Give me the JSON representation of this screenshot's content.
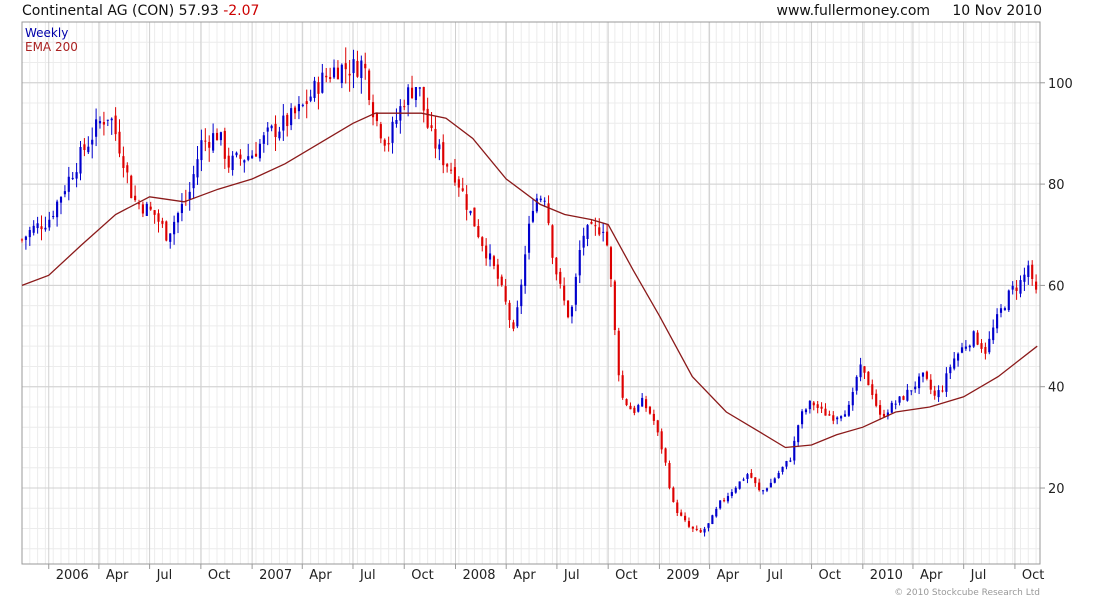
{
  "header": {
    "instrument": "Continental AG (CON)",
    "price": "57.93",
    "change": "-2.07",
    "website": "www.fullermoney.com",
    "date": "10 Nov 2010"
  },
  "footer": {
    "copyright": "© 2010 Stockcube Research Ltd"
  },
  "colors": {
    "up": "#0000cc",
    "down": "#dd0000",
    "ema": "#8b1a1a",
    "grid": "#d0d0d0",
    "frame": "#999999"
  },
  "chart_data": {
    "type": "candlestick",
    "frequency": "Weekly",
    "legend": [
      "Weekly",
      "EMA 200"
    ],
    "legend_position": "top-left",
    "ylim": [
      5,
      112
    ],
    "y_ticks": [
      20,
      40,
      60,
      80,
      100
    ],
    "y_axis_side": "right",
    "grid": true,
    "xlim": [
      "2005-11-14",
      "2010-11-15"
    ],
    "x_ticks": [
      {
        "label": "2006",
        "date": "2006-01-01"
      },
      {
        "label": "Apr",
        "date": "2006-04-01"
      },
      {
        "label": "Jul",
        "date": "2006-07-01"
      },
      {
        "label": "Oct",
        "date": "2006-10-01"
      },
      {
        "label": "2007",
        "date": "2007-01-01"
      },
      {
        "label": "Apr",
        "date": "2007-04-01"
      },
      {
        "label": "Jul",
        "date": "2007-07-01"
      },
      {
        "label": "Oct",
        "date": "2007-10-01"
      },
      {
        "label": "2008",
        "date": "2008-01-01"
      },
      {
        "label": "Apr",
        "date": "2008-04-01"
      },
      {
        "label": "Jul",
        "date": "2008-07-01"
      },
      {
        "label": "Oct",
        "date": "2008-10-01"
      },
      {
        "label": "2009",
        "date": "2009-01-01"
      },
      {
        "label": "Apr",
        "date": "2009-04-01"
      },
      {
        "label": "Jul",
        "date": "2009-07-01"
      },
      {
        "label": "Oct",
        "date": "2009-10-01"
      },
      {
        "label": "2010",
        "date": "2010-01-01"
      },
      {
        "label": "Apr",
        "date": "2010-04-01"
      },
      {
        "label": "Jul",
        "date": "2010-07-01"
      },
      {
        "label": "Oct",
        "date": "2010-10-01"
      }
    ],
    "price_path": [
      [
        "2005-11-14",
        69
      ],
      [
        "2005-12-01",
        71
      ],
      [
        "2006-01-01",
        73
      ],
      [
        "2006-02-01",
        80
      ],
      [
        "2006-03-01",
        86
      ],
      [
        "2006-04-01",
        92
      ],
      [
        "2006-04-20",
        94
      ],
      [
        "2006-05-15",
        85
      ],
      [
        "2006-06-01",
        77
      ],
      [
        "2006-06-15",
        76
      ],
      [
        "2006-07-10",
        74
      ],
      [
        "2006-08-01",
        70
      ],
      [
        "2006-08-20",
        74
      ],
      [
        "2006-09-10",
        78
      ],
      [
        "2006-10-01",
        88
      ],
      [
        "2006-11-01",
        90
      ],
      [
        "2006-11-20",
        84
      ],
      [
        "2006-12-10",
        85
      ],
      [
        "2007-01-01",
        86
      ],
      [
        "2007-02-01",
        90
      ],
      [
        "2007-03-01",
        92
      ],
      [
        "2007-04-01",
        95
      ],
      [
        "2007-05-01",
        100
      ],
      [
        "2007-06-01",
        103
      ],
      [
        "2007-07-01",
        103
      ],
      [
        "2007-07-20",
        104
      ],
      [
        "2007-08-10",
        93
      ],
      [
        "2007-09-01",
        88
      ],
      [
        "2007-10-01",
        97
      ],
      [
        "2007-10-25",
        100
      ],
      [
        "2007-11-15",
        90
      ],
      [
        "2007-12-10",
        85
      ],
      [
        "2008-01-01",
        82
      ],
      [
        "2008-01-25",
        75
      ],
      [
        "2008-02-20",
        68
      ],
      [
        "2008-03-15",
        62
      ],
      [
        "2008-04-01",
        56
      ],
      [
        "2008-04-15",
        50
      ],
      [
        "2008-05-01",
        63
      ],
      [
        "2008-05-20",
        77
      ],
      [
        "2008-06-10",
        78
      ],
      [
        "2008-06-25",
        65
      ],
      [
        "2008-07-10",
        58
      ],
      [
        "2008-07-25",
        53
      ],
      [
        "2008-08-15",
        70
      ],
      [
        "2008-09-10",
        71
      ],
      [
        "2008-09-25",
        72
      ],
      [
        "2008-10-05",
        62
      ],
      [
        "2008-10-15",
        48
      ],
      [
        "2008-10-25",
        38
      ],
      [
        "2008-11-15",
        35
      ],
      [
        "2008-12-01",
        37
      ],
      [
        "2008-12-20",
        34
      ],
      [
        "2009-01-10",
        26
      ],
      [
        "2009-01-25",
        17
      ],
      [
        "2009-02-10",
        14
      ],
      [
        "2009-02-25",
        12
      ],
      [
        "2009-03-15",
        11
      ],
      [
        "2009-04-01",
        13
      ],
      [
        "2009-04-20",
        17
      ],
      [
        "2009-05-15",
        20
      ],
      [
        "2009-06-10",
        23
      ],
      [
        "2009-07-01",
        19
      ],
      [
        "2009-07-20",
        21
      ],
      [
        "2009-08-10",
        24
      ],
      [
        "2009-08-25",
        26
      ],
      [
        "2009-09-10",
        34
      ],
      [
        "2009-10-01",
        37
      ],
      [
        "2009-10-20",
        35
      ],
      [
        "2009-11-10",
        34
      ],
      [
        "2009-12-10",
        36
      ],
      [
        "2009-12-25",
        44
      ],
      [
        "2010-01-15",
        40
      ],
      [
        "2010-02-01",
        34
      ],
      [
        "2010-02-20",
        36
      ],
      [
        "2010-03-15",
        38
      ],
      [
        "2010-04-01",
        40
      ],
      [
        "2010-04-20",
        42
      ],
      [
        "2010-05-10",
        38
      ],
      [
        "2010-05-25",
        40
      ],
      [
        "2010-06-10",
        45
      ],
      [
        "2010-07-01",
        48
      ],
      [
        "2010-07-20",
        50
      ],
      [
        "2010-08-10",
        47
      ],
      [
        "2010-08-25",
        52
      ],
      [
        "2010-09-10",
        56
      ],
      [
        "2010-09-25",
        59
      ],
      [
        "2010-10-15",
        61
      ],
      [
        "2010-10-25",
        64
      ],
      [
        "2010-11-01",
        60
      ],
      [
        "2010-11-10",
        57.93
      ]
    ],
    "ema_path": [
      [
        "2005-11-14",
        60
      ],
      [
        "2006-01-01",
        62
      ],
      [
        "2006-03-01",
        68
      ],
      [
        "2006-05-01",
        74
      ],
      [
        "2006-07-01",
        77.5
      ],
      [
        "2006-09-01",
        76.5
      ],
      [
        "2006-11-01",
        79
      ],
      [
        "2007-01-01",
        81
      ],
      [
        "2007-03-01",
        84
      ],
      [
        "2007-05-01",
        88
      ],
      [
        "2007-07-01",
        92
      ],
      [
        "2007-08-10",
        94
      ],
      [
        "2007-09-15",
        94
      ],
      [
        "2007-11-01",
        94
      ],
      [
        "2007-12-15",
        93
      ],
      [
        "2008-02-01",
        89
      ],
      [
        "2008-04-01",
        81
      ],
      [
        "2008-06-01",
        76
      ],
      [
        "2008-07-15",
        74
      ],
      [
        "2008-09-01",
        73
      ],
      [
        "2008-10-01",
        72
      ],
      [
        "2008-11-15",
        63
      ],
      [
        "2009-01-01",
        54
      ],
      [
        "2009-03-01",
        42
      ],
      [
        "2009-05-01",
        35
      ],
      [
        "2009-07-01",
        31
      ],
      [
        "2009-08-15",
        28
      ],
      [
        "2009-10-01",
        28.5
      ],
      [
        "2009-11-15",
        30.5
      ],
      [
        "2010-01-01",
        32
      ],
      [
        "2010-03-01",
        35
      ],
      [
        "2010-05-01",
        36
      ],
      [
        "2010-07-01",
        38
      ],
      [
        "2010-09-01",
        42
      ],
      [
        "2010-11-10",
        48
      ]
    ]
  }
}
